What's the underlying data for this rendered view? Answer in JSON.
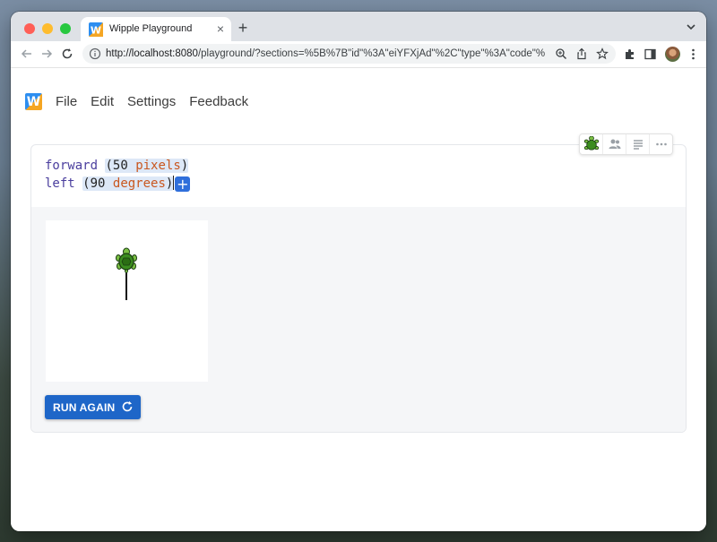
{
  "browser": {
    "tab_title": "Wipple Playground",
    "tab_close": "×",
    "new_tab": "+",
    "url_host": "http://localhost:8080",
    "url_path": "/playground/?sections=%5B%7B\"id\"%3A\"eiYFXjAd\"%2C\"type\"%3A\"code\"%2C\"v..."
  },
  "app": {
    "logo_letter": "W",
    "menu": [
      "File",
      "Edit",
      "Settings",
      "Feedback"
    ]
  },
  "editor": {
    "line1": {
      "keyword": "forward",
      "open": "(",
      "value": "50",
      "unit": "pixels",
      "close": ")"
    },
    "line2": {
      "keyword": "left",
      "open": "(",
      "value": "90",
      "unit": "degrees",
      "close": ")"
    },
    "add_label": "+"
  },
  "output": {
    "run_label": "RUN AGAIN"
  },
  "colors": {
    "accent": "#1e66c8",
    "keyword": "#4b3f9e",
    "unit": "#c9571f",
    "arg_highlight": "#dde8f7"
  }
}
